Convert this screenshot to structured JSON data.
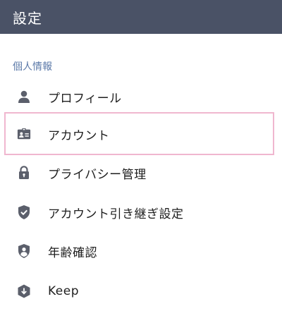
{
  "header": {
    "title": "設定"
  },
  "section": {
    "label": "個人情報"
  },
  "menu": {
    "items": [
      {
        "label": "プロフィール",
        "icon": "person-icon"
      },
      {
        "label": "アカウント",
        "icon": "id-card-icon"
      },
      {
        "label": "プライバシー管理",
        "icon": "lock-icon"
      },
      {
        "label": "アカウント引き継ぎ設定",
        "icon": "shield-check-icon"
      },
      {
        "label": "年齢確認",
        "icon": "shield-person-icon"
      },
      {
        "label": "Keep",
        "icon": "keep-download-icon"
      }
    ]
  },
  "colors": {
    "header_bg": "#4a5266",
    "section_label": "#5b79a8",
    "icon": "#5b5f6b",
    "highlight_border": "#f0b7cf"
  }
}
